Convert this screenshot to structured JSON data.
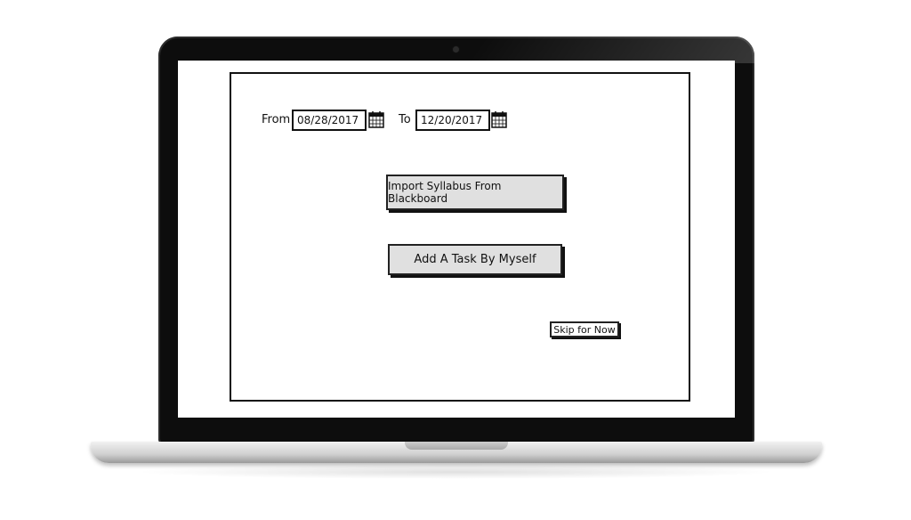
{
  "date_range": {
    "from_label": "From",
    "from_value": "08/28/2017",
    "to_label": "To",
    "to_value": "12/20/2017"
  },
  "actions": {
    "import_label": "Import Syllabus From Blackboard",
    "add_task_label": "Add A Task By Myself",
    "skip_label": "Skip for Now"
  },
  "icons": {
    "calendar": "calendar-icon"
  }
}
